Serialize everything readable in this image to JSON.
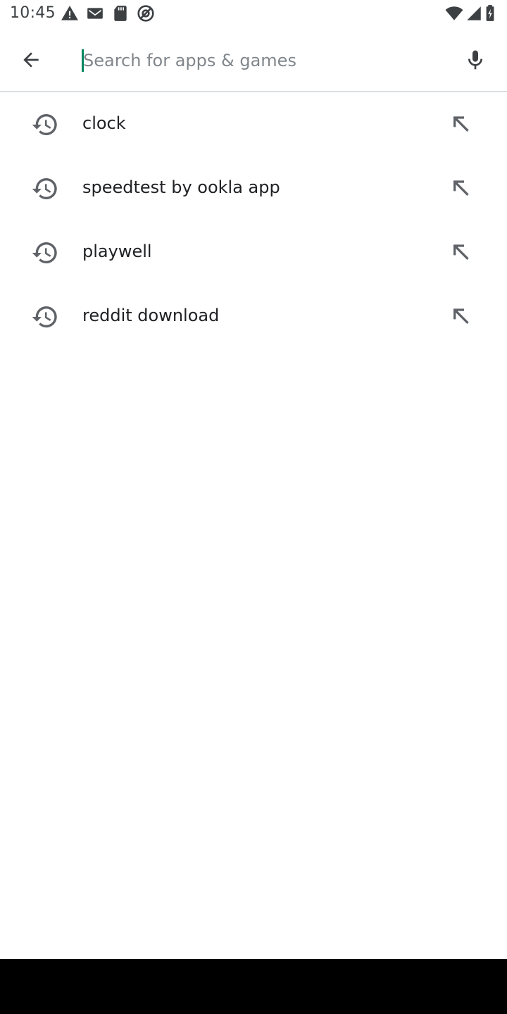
{
  "status_bar": {
    "time": "10:45",
    "left_icons": [
      "warning-icon",
      "gmail-icon",
      "sd-card-icon",
      "at-sign-icon"
    ],
    "right_icons": [
      "wifi-icon",
      "cellular-signal-icon",
      "battery-icon"
    ]
  },
  "search": {
    "placeholder": "Search for apps & games",
    "value": "",
    "accent_color": "#01875f"
  },
  "suggestions": [
    {
      "label": "clock",
      "icon": "history-icon",
      "action_icon": "fill-query-arrow-icon"
    },
    {
      "label": "speedtest by ookla app",
      "icon": "history-icon",
      "action_icon": "fill-query-arrow-icon"
    },
    {
      "label": "playwell",
      "icon": "history-icon",
      "action_icon": "fill-query-arrow-icon"
    },
    {
      "label": "reddit download",
      "icon": "history-icon",
      "action_icon": "fill-query-arrow-icon"
    }
  ]
}
